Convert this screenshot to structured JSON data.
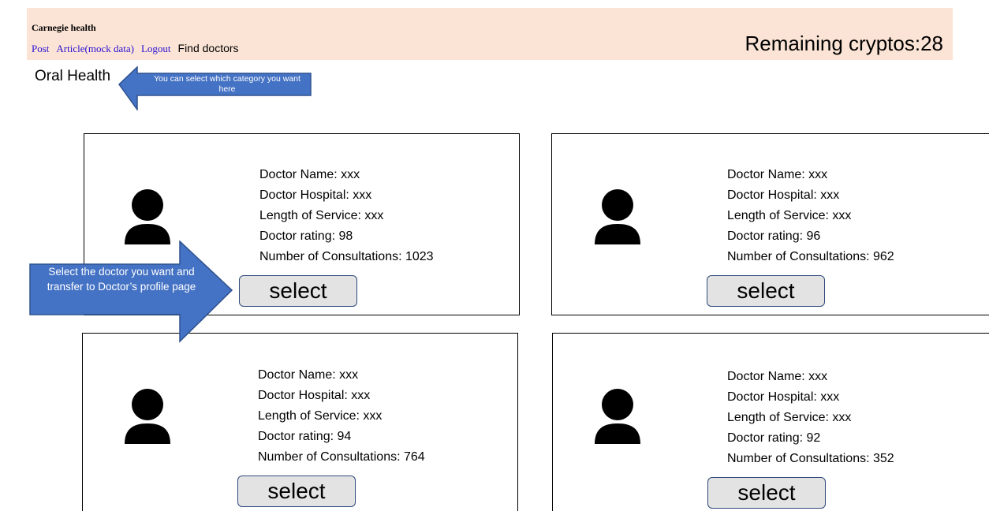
{
  "header": {
    "brand": "Carnegie health",
    "nav": [
      "Post",
      "Article(mock data)",
      "Logout"
    ],
    "current_page": "Find doctors",
    "remaining_cryptos": "Remaining cryptos:28"
  },
  "category": {
    "selected": "Oral Health",
    "annotation": "You can select which category you want here"
  },
  "select_annotation": "Select the doctor you want and transfer to Doctor’s profile page",
  "doctors": [
    {
      "name": "Doctor Name: xxx",
      "hospital": "Doctor Hospital: xxx",
      "service": "Length of Service: xxx",
      "rating": "Doctor rating: 98",
      "consultations": "Number of Consultations: 1023",
      "button": "select"
    },
    {
      "name": "Doctor Name: xxx",
      "hospital": "Doctor Hospital: xxx",
      "service": "Length of Service: xxx",
      "rating": "Doctor rating: 96",
      "consultations": "Number of Consultations: 962",
      "button": "select"
    },
    {
      "name": "Doctor Name: xxx",
      "hospital": "Doctor Hospital: xxx",
      "service": "Length of Service: xxx",
      "rating": "Doctor rating: 94",
      "consultations": "Number of Consultations: 764",
      "button": "select"
    },
    {
      "name": "Doctor Name: xxx",
      "hospital": "Doctor Hospital: xxx",
      "service": "Length of Service: xxx",
      "rating": "Doctor rating: 92",
      "consultations": "Number of Consultations: 352",
      "button": "select"
    }
  ],
  "colors": {
    "header_bg": "#fbe4d5",
    "link": "#2a0fd4",
    "annotation_fill": "#4472c4",
    "annotation_stroke": "#2f528f",
    "button_bg": "#e3e3e3"
  },
  "icons": [
    "user-avatar-icon"
  ]
}
